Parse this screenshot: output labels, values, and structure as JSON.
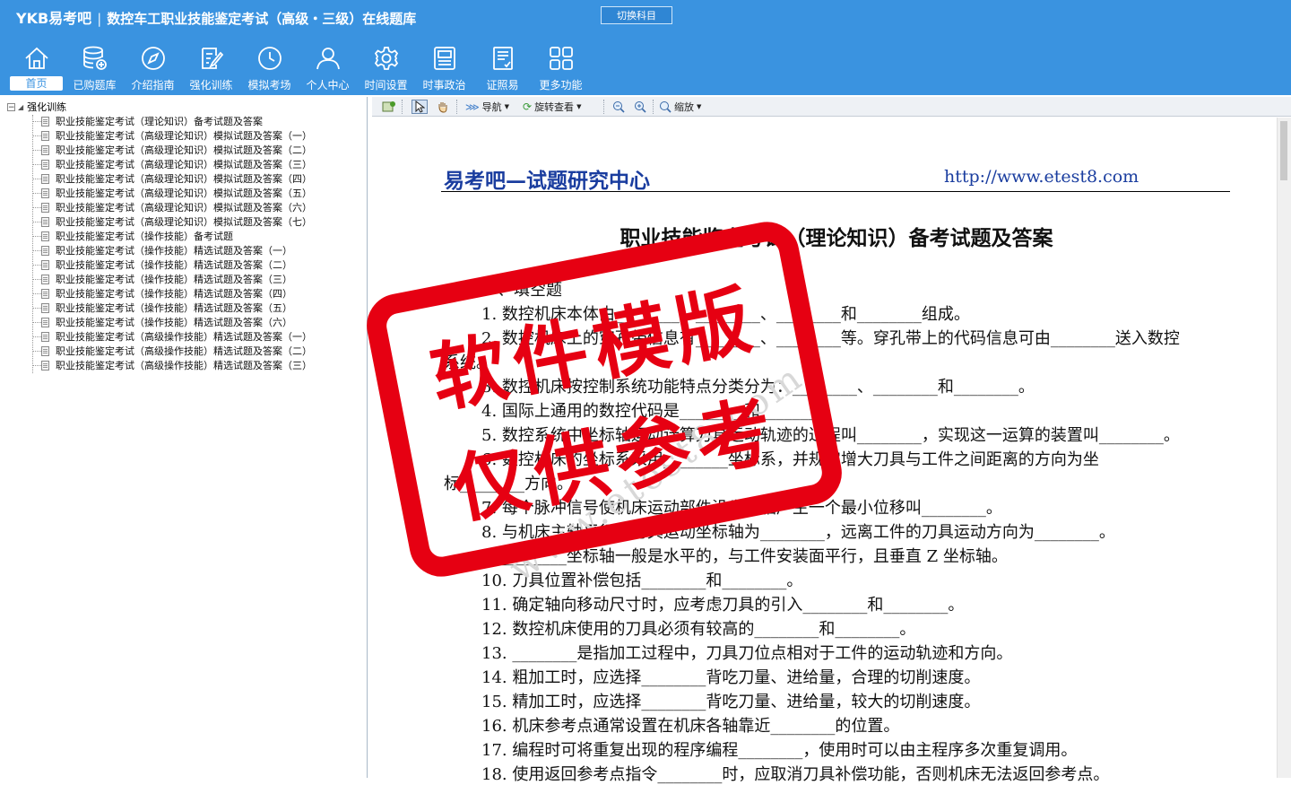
{
  "header": {
    "logo_text": "YKB易考吧",
    "separator": "|",
    "title": "数控车工职业技能鉴定考试（高级・三级）在线题库",
    "switch_button": "切换科目"
  },
  "nav": [
    {
      "label": "首页",
      "icon": "home-icon"
    },
    {
      "label": "已购题库",
      "icon": "database-icon"
    },
    {
      "label": "介绍指南",
      "icon": "compass-icon"
    },
    {
      "label": "强化训练",
      "icon": "edit-icon"
    },
    {
      "label": "模拟考场",
      "icon": "clock-icon"
    },
    {
      "label": "个人中心",
      "icon": "user-icon"
    },
    {
      "label": "时间设置",
      "icon": "gear-icon"
    },
    {
      "label": "时事政治",
      "icon": "news-icon"
    },
    {
      "label": "证照易",
      "icon": "certificate-icon"
    },
    {
      "label": "更多功能",
      "icon": "grid-icon"
    }
  ],
  "tree": {
    "root": "强化训练",
    "expander": "−",
    "items": [
      "职业技能鉴定考试（理论知识）备考试题及答案",
      "职业技能鉴定考试（高级理论知识）模拟试题及答案（一）",
      "职业技能鉴定考试（高级理论知识）模拟试题及答案（二）",
      "职业技能鉴定考试（高级理论知识）模拟试题及答案（三）",
      "职业技能鉴定考试（高级理论知识）模拟试题及答案（四）",
      "职业技能鉴定考试（高级理论知识）模拟试题及答案（五）",
      "职业技能鉴定考试（高级理论知识）模拟试题及答案（六）",
      "职业技能鉴定考试（高级理论知识）模拟试题及答案（七）",
      "职业技能鉴定考试（操作技能）备考试题",
      "职业技能鉴定考试（操作技能）精选试题及答案（一）",
      "职业技能鉴定考试（操作技能）精选试题及答案（二）",
      "职业技能鉴定考试（操作技能）精选试题及答案（三）",
      "职业技能鉴定考试（操作技能）精选试题及答案（四）",
      "职业技能鉴定考试（操作技能）精选试题及答案（五）",
      "职业技能鉴定考试（操作技能）精选试题及答案（六）",
      "职业技能鉴定考试（高级操作技能）精选试题及答案（一）",
      "职业技能鉴定考试（高级操作技能）精选试题及答案（二）",
      "职业技能鉴定考试（高级操作技能）精选试题及答案（三）"
    ]
  },
  "toolbar": {
    "nav_label": "导航",
    "rotate_label": "旋转查看",
    "zoom_label": "缩放"
  },
  "document": {
    "header_left": "易考吧—试题研究中心",
    "header_right": "http://www.etest8.com",
    "title": "职业技能鉴定考试（理论知识）备考试题及答案",
    "section": "一、填空题",
    "questions": [
      "1. 数控机床本体由________、________、________和________组成。",
      "2. 数控机床上的穿孔带信息有________、________等。穿孔带上的代码信息可由________送入数控",
      "系统。",
      "3. 数控机床按控制系统功能特点分类分为：________、________和________。",
      "4. 国际上通用的数控代码是________和________。",
      "5. 数控系统中坐标轴运动计算刀具运动轨迹的过程叫________，实现这一运算的装置叫________。",
      "6. 数控机床的坐标系采用________坐标系，并规定增大刀具与工件之间距离的方向为坐",
      "标________方向。",
      "7. 每个脉冲信号使机床运动部件沿坐标轴产生一个最小位移叫________。",
      "8. 与机床主轴平行的刀具运动坐标轴为________，远离工件的刀具运动方向为________。",
      "9. ________坐标轴一般是水平的，与工件安装面平行，且垂直 Z 坐标轴。",
      "10. 刀具位置补偿包括________和________。",
      "11. 确定轴向移动尺寸时，应考虑刀具的引入________和________。",
      "12. 数控机床使用的刀具必须有较高的________和________。",
      "13. ________是指加工过程中，刀具刀位点相对于工件的运动轨迹和方向。",
      "14. 粗加工时，应选择________背吃刀量、进给量，合理的切削速度。",
      "15. 精加工时，应选择________背吃刀量、进给量，较大的切削速度。",
      "16. 机床参考点通常设置在机床各轴靠近________的位置。",
      "17. 编程时可将重复出现的程序编程________，使用时可以由主程序多次重复调用。",
      "18. 使用返回参考点指令________时，应取消刀具补偿功能，否则机床无法返回参考点。"
    ]
  },
  "stamp": {
    "line1": "软件模版",
    "line2": "仅供参考",
    "color": "#e60012"
  },
  "watermark": "www.etest8.com",
  "colors": {
    "topbar": "#3a93e0",
    "doc_header": "#1a3d9f"
  }
}
